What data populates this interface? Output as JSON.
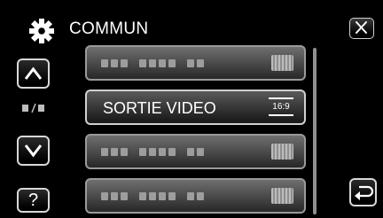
{
  "header": {
    "icon": "gear-icon",
    "title": "COMMUN",
    "close_icon": "close-icon"
  },
  "sidebar": {
    "up_icon": "chevron-up-icon",
    "down_icon": "chevron-down-icon",
    "page_indicator_icon": "page-indicator-icon",
    "help_label": "?"
  },
  "menu": {
    "items": [
      {
        "label": "",
        "state": "obscured"
      },
      {
        "label": "SORTIE VIDEO",
        "value": "16:9",
        "state": "selected"
      },
      {
        "label": "",
        "state": "obscured"
      },
      {
        "label": "",
        "state": "obscured"
      }
    ]
  },
  "footer": {
    "back_icon": "return-icon"
  }
}
